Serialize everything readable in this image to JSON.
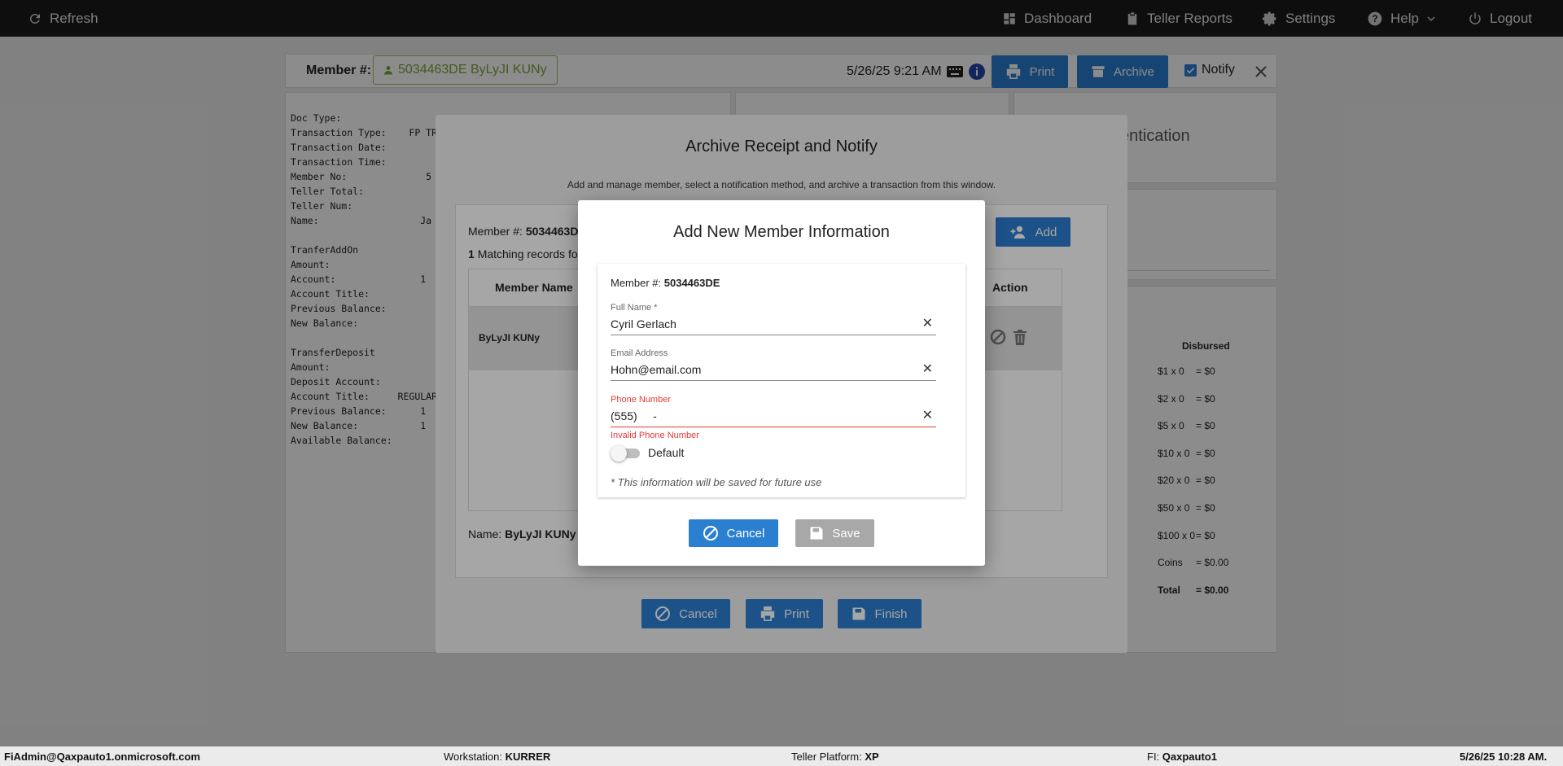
{
  "topbar": {
    "refresh": "Refresh",
    "dashboard": "Dashboard",
    "teller_reports": "Teller Reports",
    "settings": "Settings",
    "help": "Help",
    "logout": "Logout"
  },
  "member_bar": {
    "label": "Member #:",
    "member_chip": "5034463DE ByLyJI KUNy",
    "datetime": "5/26/25 9:21 AM",
    "print": "Print",
    "archive": "Archive",
    "notify": "Notify"
  },
  "receipt_lines": "Doc Type:\nTransaction Type:    FP TRA\nTransaction Date:\nTransaction Time:\nMember No:              5\nTeller Total:\nTeller Num:\nName:                  Ja\n\nTranferAddOn\nAmount:\nAccount:               1\nAccount Title:\nPrevious Balance:\nNew Balance:\n\nTransferDeposit\nAmount:\nDeposit Account:\nAccount Title:     REGULAR\nPrevious Balance:      1\nNew Balance:           1\nAvailable Balance:",
  "right_panel": {
    "auth_fragment": "entication",
    "disbursed_header": "Disbursed",
    "rows": [
      {
        "denom": "$1 x 0",
        "amount": "= $0"
      },
      {
        "denom": "$2 x 0",
        "amount": "= $0"
      },
      {
        "denom": "$5 x 0",
        "amount": "= $0"
      },
      {
        "denom": "$10 x 0",
        "amount": "= $0"
      },
      {
        "denom": "$20 x 0",
        "amount": "= $0"
      },
      {
        "denom": "$50 x 0",
        "amount": "= $0"
      },
      {
        "denom": "$100 x 0",
        "amount": "= $0"
      },
      {
        "denom": "Coins",
        "amount": "= $0.00"
      },
      {
        "denom": "Total",
        "amount": "= $0.00"
      }
    ]
  },
  "archive_dialog": {
    "title": "Archive Receipt and Notify",
    "subtitle": "Add and manage member, select a notification method, and archive a transaction from this window.",
    "member_label": "Member #:",
    "member_value": "5034463D",
    "matching_count": "1",
    "matching_text": "Matching records fo",
    "add_button": "Add",
    "col_member_name": "Member Name",
    "col_action": "Action",
    "row_name": "ByLyJI KUNy",
    "name_label": "Name:",
    "name_value": "ByLyJI KUNy",
    "cancel": "Cancel",
    "print": "Print",
    "finish": "Finish"
  },
  "modal": {
    "title": "Add New Member Information",
    "member_label": "Member #:",
    "member_value": "5034463DE",
    "full_name_label": "Full Name *",
    "full_name_value": "Cyril Gerlach",
    "email_label": "Email Address",
    "email_value": "Hohn@email.com",
    "phone_label": "Phone Number",
    "phone_value": "(555)     -",
    "phone_error": "Invalid Phone Number",
    "default_label": "Default",
    "note": "* This information will be saved for future use",
    "cancel": "Cancel",
    "save": "Save"
  },
  "statusbar": {
    "user": "FiAdmin@Qaxpauto1.onmicrosoft.com",
    "workstation_label": "Workstation:",
    "workstation_value": "KURRER",
    "platform_label": "Teller Platform:",
    "platform_value": "XP",
    "fi_label": "FI:",
    "fi_value": "Qaxpauto1",
    "datetime": "5/26/25 10:28 AM."
  },
  "colors": {
    "primary": "#2b7fd1",
    "topbar": "#1b1b1b",
    "error": "#e53935",
    "member_green": "#7aa63a"
  }
}
